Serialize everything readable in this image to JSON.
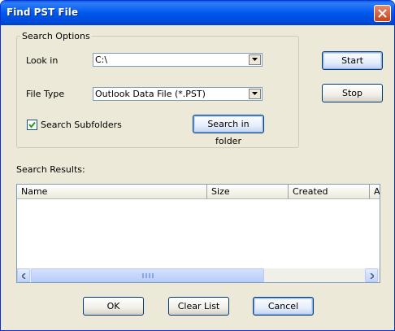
{
  "window": {
    "title": "Find PST File"
  },
  "search_options": {
    "legend": "Search Options",
    "look_in_label": "Look in",
    "look_in_value": "C:\\",
    "file_type_label": "File Type",
    "file_type_value": "Outlook Data File (*.PST)",
    "subfolders_label": "Search Subfolders",
    "subfolders_checked": true,
    "search_in_folder_label": "Search in folder"
  },
  "side_buttons": {
    "start_label": "Start",
    "stop_label": "Stop"
  },
  "results": {
    "label": "Search Results:",
    "columns": [
      "Name",
      "Size",
      "Created",
      "A"
    ],
    "rows": []
  },
  "footer": {
    "ok_label": "OK",
    "clear_label": "Clear List",
    "cancel_label": "Cancel"
  },
  "colors": {
    "titlebar": "#0058ee",
    "dialog_bg": "#ece9d8",
    "close_button": "#c9421c",
    "button_border": "#003c74"
  }
}
